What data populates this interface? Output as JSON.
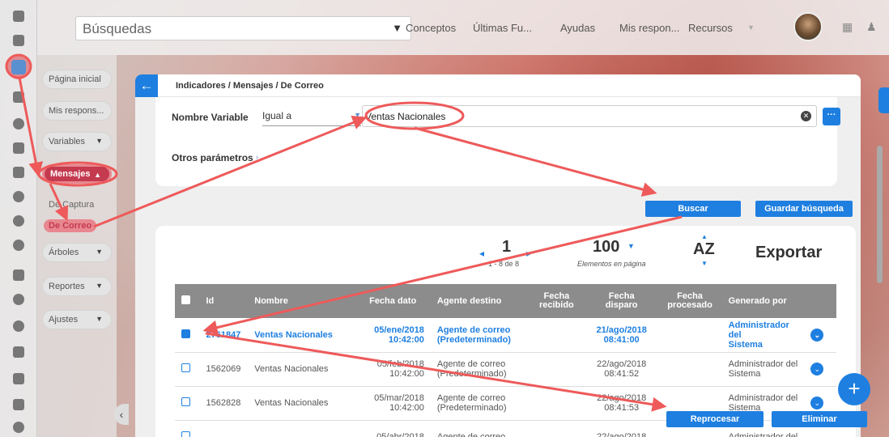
{
  "topbar": {
    "search_label": "Búsquedas",
    "nav": [
      "Conceptos",
      "Últimas Fu...",
      "Ayudas",
      "Mis respon...",
      "Recursos"
    ]
  },
  "sidemenu": {
    "items": [
      {
        "label": "Página inicial",
        "caret": false
      },
      {
        "label": "Mis respons...",
        "caret": false
      },
      {
        "label": "Variables",
        "caret": true
      },
      {
        "label": "Mensajes",
        "caret": true,
        "selected": true
      },
      {
        "label": "Árboles",
        "caret": true
      },
      {
        "label": "Reportes",
        "caret": true
      },
      {
        "label": "Ajustes",
        "caret": true
      }
    ],
    "subitems": [
      "De Captura",
      "De Correo"
    ]
  },
  "panel": {
    "breadcrumb": "Indicadores / Mensajes / De Correo",
    "filter": {
      "field_label": "Nombre Variable",
      "operator": "Igual a",
      "value": "Ventas Nacionales",
      "other_params": "Otros parámetros"
    },
    "buttons": {
      "search": "Buscar",
      "save_search": "Guardar búsqueda"
    },
    "pagination": {
      "page": "1",
      "range": "1 - 8 de 8",
      "per_page": "100",
      "per_page_label": "Elementos en página",
      "sort": "AZ",
      "export": "Exportar"
    },
    "table": {
      "headers": [
        "Id",
        "Nombre",
        "Fecha dato",
        "Agente destino",
        "Fecha recibido",
        "Fecha disparo",
        "Fecha procesado",
        "Generado por"
      ],
      "rows": [
        {
          "id": "2761847",
          "name": "Ventas Nacionales",
          "date": "05/ene/2018",
          "time": "10:42:00",
          "agent1": "Agente de correo",
          "agent2": "(Predeterminado)",
          "fire_date": "21/ago/2018",
          "fire_time": "08:41:00",
          "by1": "Administrador del",
          "by2": "Sistema",
          "selected": true
        },
        {
          "id": "1562069",
          "name": "Ventas Nacionales",
          "date": "05/feb/2018",
          "time": "10:42:00",
          "agent1": "Agente de correo",
          "agent2": "(Predeterminado)",
          "fire_date": "22/ago/2018",
          "fire_time": "08:41:52",
          "by1": "Administrador del",
          "by2": "Sistema",
          "selected": false
        },
        {
          "id": "1562828",
          "name": "Ventas Nacionales",
          "date": "05/mar/2018",
          "time": "10:42:00",
          "agent1": "Agente de correo",
          "agent2": "(Predeterminado)",
          "fire_date": "22/ago/2018",
          "fire_time": "08:41:53",
          "by1": "Administrador del",
          "by2": "Sistema",
          "selected": false
        },
        {
          "id": "",
          "name": "",
          "date": "05/abr/2018",
          "time": "",
          "agent1": "Agente de correo",
          "agent2": "",
          "fire_date": "22/ago/2018",
          "fire_time": "",
          "by1": "Administrador del",
          "by2": "",
          "selected": false
        }
      ]
    },
    "row_actions": {
      "reprocess": "Reprocesar",
      "delete": "Eliminar"
    }
  },
  "colors": {
    "accent": "#1e7fe0",
    "highlight": "#c43a4f",
    "annotation": "#ee5a5a"
  }
}
